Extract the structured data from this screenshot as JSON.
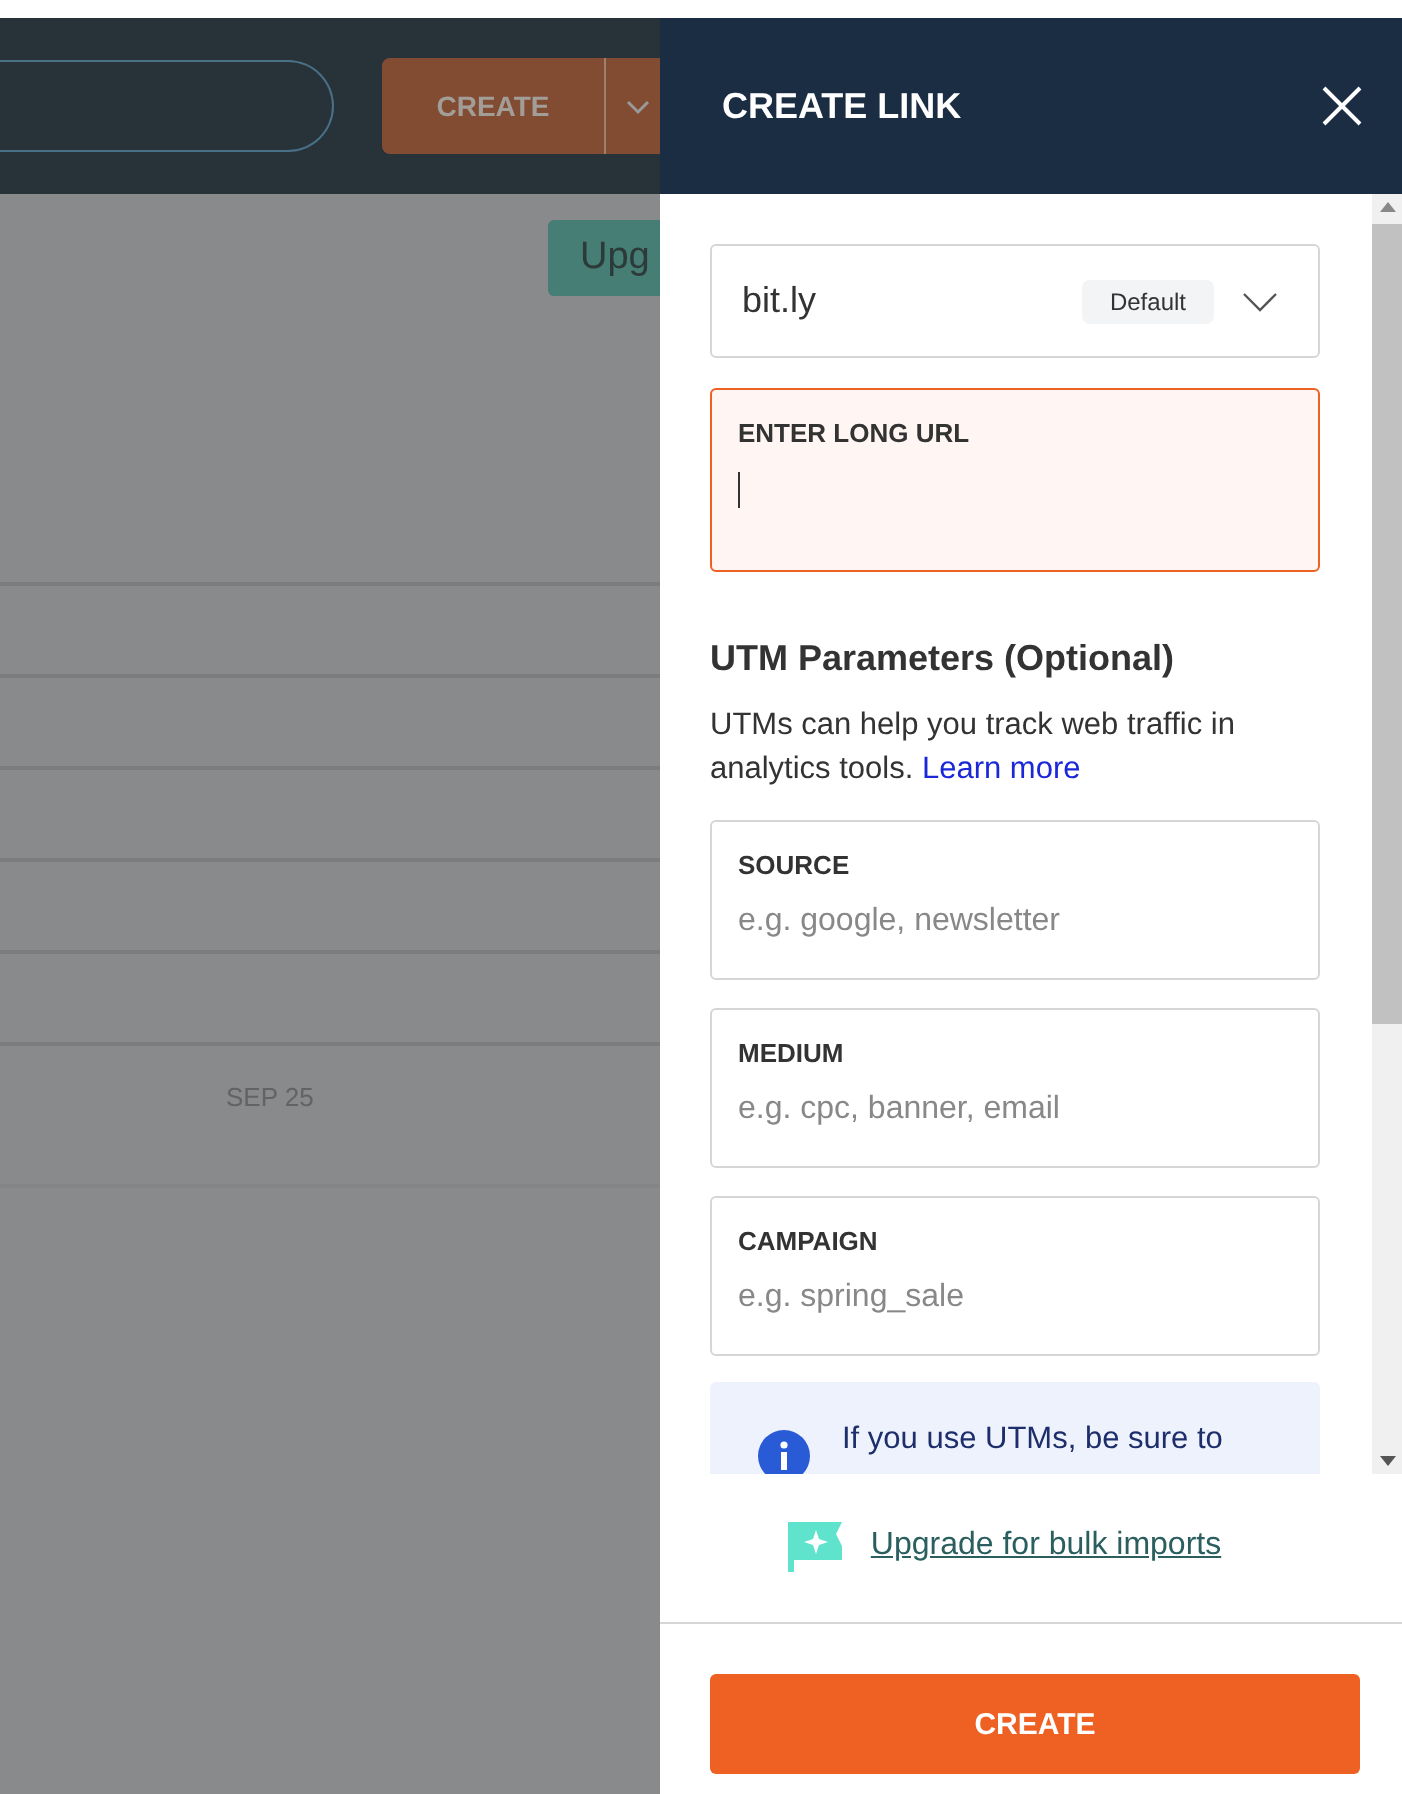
{
  "background": {
    "header": {
      "create_button": "CREATE",
      "upgrade_button": "Upg"
    },
    "chart": {
      "axis_label": "SEP 25"
    }
  },
  "panel": {
    "title": "CREATE LINK",
    "domain": {
      "value": "bit.ly",
      "badge": "Default"
    },
    "long_url": {
      "label": "ENTER LONG URL",
      "focused": true
    },
    "utm": {
      "heading": "UTM Parameters (Optional)",
      "description": "UTMs can help you track web traffic in analytics tools.",
      "link": "Learn more",
      "fields": [
        {
          "label": "SOURCE",
          "placeholder": "e.g. google, newsletter"
        },
        {
          "label": "MEDIUM",
          "placeholder": "e.g. cpc, banner, email"
        },
        {
          "label": "CAMPAIGN",
          "placeholder": "e.g. spring_sale"
        }
      ],
      "info": "If you use UTMs, be sure to"
    },
    "upgrade_link": "Upgrade for bulk imports",
    "create_button": "CREATE"
  }
}
